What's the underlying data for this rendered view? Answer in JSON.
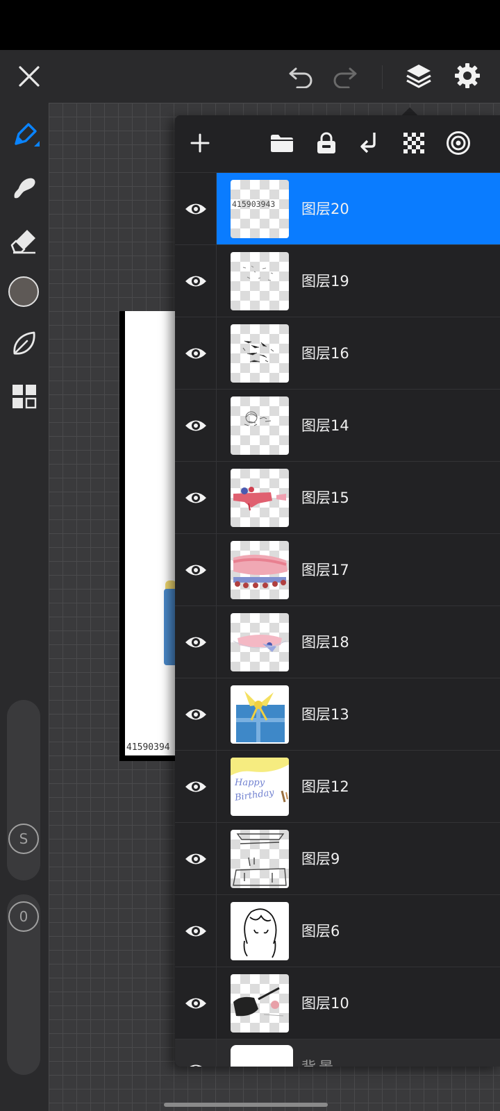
{
  "topbar": {
    "close_icon": "close-icon",
    "undo_icon": "undo-icon",
    "redo_icon": "redo-icon",
    "layers_icon": "layers-icon",
    "settings_icon": "gear-icon"
  },
  "sidebar": {
    "tools": [
      "pen-tool-icon",
      "smudge-tool-icon",
      "eraser-tool-icon",
      "color-swatch",
      "leaf-tool-icon",
      "grid-menu-icon"
    ],
    "active_color": "#5e5956",
    "accent_color": "#0a84ff",
    "size_label": "S",
    "opacity_label": "0"
  },
  "canvas": {
    "artboard_text": "41590394"
  },
  "layer_panel": {
    "toolbar_icons": [
      "add-layer-icon",
      "folder-icon",
      "lock-icon",
      "merge-down-icon",
      "alpha-lock-icon",
      "target-icon"
    ],
    "selected_color": "#0a7cff",
    "layers": [
      {
        "name": "图层20",
        "selected": true
      },
      {
        "name": "图层19"
      },
      {
        "name": "图层16"
      },
      {
        "name": "图层14"
      },
      {
        "name": "图层15"
      },
      {
        "name": "图层17"
      },
      {
        "name": "图层18"
      },
      {
        "name": "图层13"
      },
      {
        "name": "图层12"
      },
      {
        "name": "图层9"
      },
      {
        "name": "图层6"
      },
      {
        "name": "图层10"
      }
    ],
    "background_layer": {
      "name": "背景"
    },
    "thumb_texts": {
      "layer20": "415903943",
      "layer12_line1": "Happy",
      "layer12_line2": "Birthday"
    }
  }
}
